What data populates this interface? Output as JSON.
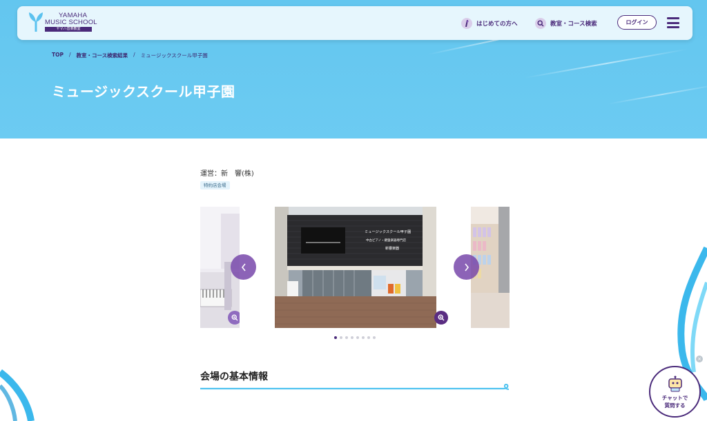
{
  "header": {
    "logo": {
      "line1": "YAMAHA",
      "line2": "MUSIC SCHOOL",
      "sub": "ヤマハ音楽教室"
    },
    "nav": [
      {
        "label": "はじめての方へ",
        "icon": "info-icon"
      },
      {
        "label": "教室・コース検索",
        "icon": "search-icon"
      }
    ],
    "login_label": "ログイン",
    "menu_icon": "hamburger-menu-icon"
  },
  "breadcrumb": {
    "items": [
      "TOP",
      "教室・コース検索結果",
      "ミュージックスクール甲子園"
    ],
    "separator": "/"
  },
  "page": {
    "title": "ミュージックスクール甲子園",
    "operator": "運営：新　響(株)",
    "badge": "特約店会場"
  },
  "carousel": {
    "slide_count": 8,
    "active_index": 0,
    "prev_icon": "chevron-left-icon",
    "next_icon": "chevron-right-icon",
    "zoom_icon": "zoom-in-icon",
    "storefront_sign": {
      "line1": "ミュージックスクール甲子園",
      "line2": "中古ピアノ・鍵盤楽器専門店",
      "line3": "新響楽器"
    }
  },
  "section": {
    "title": "会場の基本情報"
  },
  "chat": {
    "label_line1": "チャットで",
    "label_line2": "質問する",
    "icon": "robot-icon",
    "close": "×"
  },
  "colors": {
    "brand_purple": "#4a2a7a",
    "hero_blue": "#66c7f0",
    "accent_cyan": "#4fc3f0"
  }
}
